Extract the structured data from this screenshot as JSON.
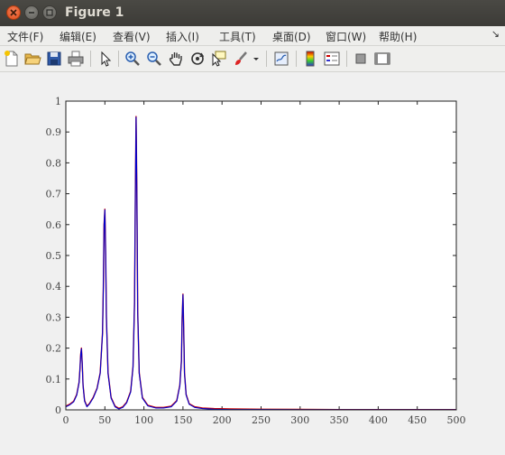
{
  "window": {
    "title": "Figure 1"
  },
  "menu": {
    "items": [
      "文件(F)",
      "编辑(E)",
      "查看(V)",
      "插入(I)",
      "工具(T)",
      "桌面(D)",
      "窗口(W)",
      "帮助(H)"
    ],
    "overflow_glyph": "↘"
  },
  "toolbar": {
    "icons": [
      "new-figure-icon",
      "open-file-icon",
      "save-icon",
      "print-icon",
      "select-arrow-icon",
      "zoom-in-icon",
      "zoom-out-icon",
      "pan-hand-icon",
      "rotate-3d-icon",
      "data-cursor-icon",
      "brush-icon",
      "brush-dropdown-icon",
      "link-plot-icon",
      "colorbar-icon",
      "legend-icon",
      "hide-plot-tools-icon",
      "show-plot-tools-icon"
    ]
  },
  "colors": {
    "line_red": "#cc0000",
    "line_blue": "#0000cc",
    "axes_bg": "#ffffff",
    "figure_bg": "#f0f0f0"
  },
  "chart_data": {
    "type": "line",
    "title": "",
    "xlabel": "",
    "ylabel": "",
    "xlim": [
      0,
      500
    ],
    "ylim": [
      0,
      1
    ],
    "xticks": [
      0,
      50,
      100,
      150,
      200,
      250,
      300,
      350,
      400,
      450,
      500
    ],
    "yticks": [
      0,
      0.1,
      0.2,
      0.3,
      0.4,
      0.5,
      0.6,
      0.7,
      0.8,
      0.9,
      1
    ],
    "grid": false,
    "peaks": [
      {
        "x": 20,
        "y": 0.2
      },
      {
        "x": 50,
        "y": 0.65
      },
      {
        "x": 90,
        "y": 0.95
      },
      {
        "x": 150,
        "y": 0.375
      }
    ],
    "series": [
      {
        "color": "#cc0000",
        "x": [
          0,
          5,
          10,
          14,
          17,
          18,
          19,
          20,
          21,
          22,
          24,
          27,
          30,
          35,
          40,
          44,
          47,
          48,
          49,
          50,
          51,
          52,
          54,
          58,
          63,
          68,
          73,
          78,
          83,
          86,
          88,
          89,
          90,
          91,
          92,
          94,
          98,
          105,
          115,
          125,
          135,
          142,
          146,
          148,
          149,
          150,
          151,
          152,
          154,
          158,
          165,
          175,
          190,
          210,
          250,
          300,
          350,
          400,
          450,
          500
        ],
        "y": [
          0.012,
          0.018,
          0.028,
          0.05,
          0.09,
          0.13,
          0.18,
          0.2,
          0.15,
          0.08,
          0.03,
          0.012,
          0.02,
          0.04,
          0.07,
          0.12,
          0.25,
          0.4,
          0.6,
          0.65,
          0.5,
          0.3,
          0.12,
          0.04,
          0.012,
          0.005,
          0.01,
          0.025,
          0.06,
          0.14,
          0.35,
          0.7,
          0.95,
          0.7,
          0.32,
          0.12,
          0.04,
          0.015,
          0.008,
          0.008,
          0.012,
          0.03,
          0.08,
          0.16,
          0.3,
          0.375,
          0.25,
          0.12,
          0.05,
          0.02,
          0.01,
          0.006,
          0.004,
          0.003,
          0.002,
          0.0015,
          0.001,
          0.001,
          0.001,
          0.001
        ]
      },
      {
        "color": "#0000cc",
        "x": [
          0,
          5,
          10,
          14,
          17,
          18,
          19,
          20,
          21,
          22,
          24,
          27,
          30,
          35,
          40,
          44,
          47,
          48,
          49,
          50,
          51,
          52,
          54,
          58,
          63,
          68,
          73,
          78,
          83,
          86,
          88,
          89,
          90,
          91,
          92,
          94,
          98,
          105,
          115,
          125,
          135,
          142,
          146,
          148,
          149,
          150,
          151,
          152,
          154,
          158,
          165,
          175,
          190,
          210,
          250,
          300,
          350,
          400,
          450,
          500
        ],
        "y": [
          0.01,
          0.016,
          0.026,
          0.048,
          0.088,
          0.128,
          0.178,
          0.198,
          0.148,
          0.078,
          0.028,
          0.01,
          0.018,
          0.038,
          0.068,
          0.118,
          0.248,
          0.398,
          0.598,
          0.648,
          0.498,
          0.298,
          0.118,
          0.038,
          0.01,
          0.003,
          0.008,
          0.023,
          0.058,
          0.138,
          0.348,
          0.698,
          0.948,
          0.698,
          0.318,
          0.118,
          0.038,
          0.013,
          0.006,
          0.006,
          0.01,
          0.028,
          0.078,
          0.158,
          0.298,
          0.373,
          0.248,
          0.118,
          0.048,
          0.018,
          0.008,
          0.004,
          0.002,
          0.001,
          0.001,
          0.0005,
          0.0005,
          0.0005,
          0.0005,
          0.0005
        ]
      }
    ]
  }
}
